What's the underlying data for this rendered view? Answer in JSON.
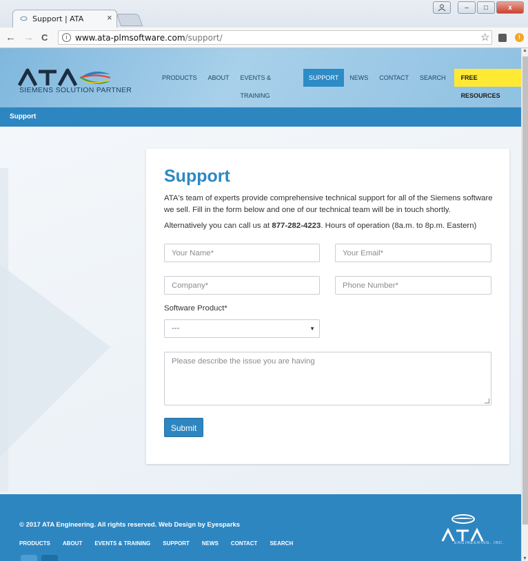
{
  "browser": {
    "tab_title": "Support | ATA",
    "tab_close": "×",
    "url_host": "www.ata-plmsoftware.com",
    "url_path": "/support/",
    "info_glyph": "i",
    "back_glyph": "←",
    "forward_glyph": "→",
    "reload_glyph": "C",
    "star_glyph": "☆",
    "alert_glyph": "!",
    "win_minimize": "–",
    "win_maximize": "□",
    "win_close": "x"
  },
  "header": {
    "logo_text": "ATA",
    "logo_sub": "SIEMENS SOLUTION PARTNER",
    "nav": [
      {
        "label": "PRODUCTS"
      },
      {
        "label": "ABOUT"
      },
      {
        "label": "EVENTS & TRAINING"
      },
      {
        "label": "SUPPORT"
      },
      {
        "label": "NEWS"
      },
      {
        "label": "CONTACT"
      },
      {
        "label": "SEARCH"
      },
      {
        "label": "FREE RESOURCES"
      }
    ]
  },
  "breadcrumb": {
    "label": "Support"
  },
  "card": {
    "title": "Support",
    "intro": "ATA's team of experts provide comprehensive technical support for all of the Siemens software we sell. Fill in the form below and one of our technical team will be in touch shortly.",
    "alt_prefix": "Alternatively you can call us at ",
    "phone": "877-282-4223",
    "alt_suffix": ". Hours of operation (8a.m. to 8p.m. Eastern)"
  },
  "form": {
    "name_placeholder": "Your Name*",
    "email_placeholder": "Your Email*",
    "company_placeholder": "Company*",
    "phone_placeholder": "Phone Number*",
    "software_label": "Software Product*",
    "software_selected": "---",
    "description_placeholder": "Please describe the issue you are having",
    "submit_label": "Submit"
  },
  "footer": {
    "copyright": "© 2017 ATA Engineering. All rights reserved. Web Design by Eyesparks",
    "nav": [
      {
        "label": "PRODUCTS"
      },
      {
        "label": "ABOUT"
      },
      {
        "label": "EVENTS & TRAINING"
      },
      {
        "label": "SUPPORT"
      },
      {
        "label": "NEWS"
      },
      {
        "label": "CONTACT"
      },
      {
        "label": "SEARCH"
      }
    ],
    "logo_text": "ATA",
    "logo_sub": "ENGINEERING, INC."
  },
  "colors": {
    "brand_blue": "#2e86c1",
    "title_blue": "#2d88c4",
    "cta_yellow": "#ffe935"
  }
}
